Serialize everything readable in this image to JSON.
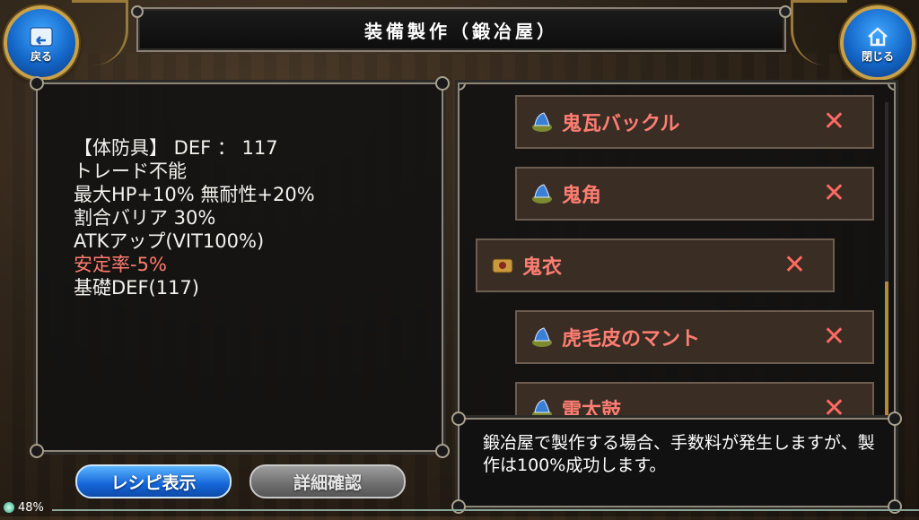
{
  "header": {
    "title": "装備製作（鍛冶屋）",
    "back_label": "戻る",
    "close_label": "閉じる"
  },
  "info": {
    "lines": [
      "【体防具】 DEF ： 117",
      "トレード不能",
      "最大HP+10% 無耐性+20%",
      "割合バリア 30%",
      "ATKアップ(VIT100%)",
      "安定率-5%",
      "基礎DEF(117)"
    ],
    "highlight_color": "#ff7b6e"
  },
  "materials": [
    {
      "name": "鬼瓦バックル",
      "icon": "blue-ore-icon",
      "status": "✕"
    },
    {
      "name": "鬼角",
      "icon": "blue-ore-icon",
      "status": "✕"
    },
    {
      "name": "鬼衣",
      "icon": "cloth-icon",
      "status": "✕"
    },
    {
      "name": "虎毛皮のマント",
      "icon": "blue-ore-icon",
      "status": "✕"
    },
    {
      "name": "雷太鼓",
      "icon": "blue-ore-icon",
      "status": "✕"
    }
  ],
  "message": {
    "text": "鍛冶屋で製作する場合、手数料が発生しますが、製作は100%成功します。"
  },
  "buttons": {
    "recipe_label": "レシピ表示",
    "detail_label": "詳細確認"
  },
  "status_bar": {
    "battery": "48%"
  },
  "colors": {
    "accent_blue": "#1467c8",
    "missing_red": "#ff6a62",
    "gold": "#c8a14a"
  }
}
